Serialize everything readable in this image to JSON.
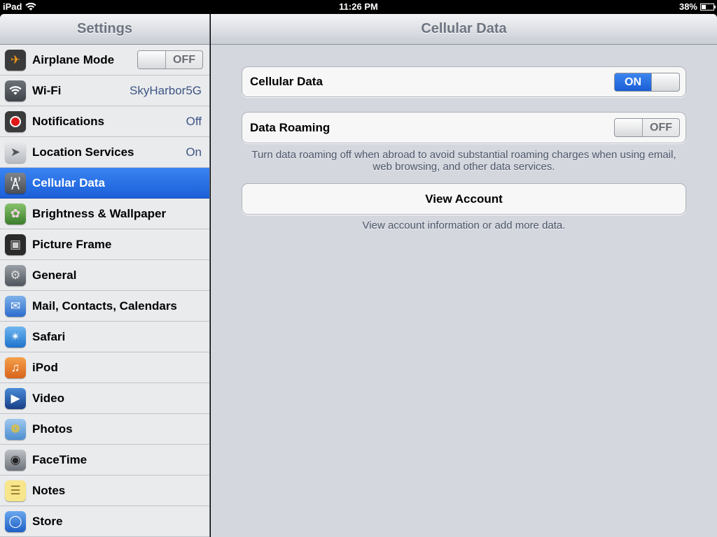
{
  "status": {
    "device": "iPad",
    "time": "11:26 PM",
    "battery": "38%",
    "battery_level": 0.38
  },
  "sidebar": {
    "title": "Settings",
    "items": [
      {
        "label": "Airplane Mode",
        "switch": "OFF",
        "icon": "airplane-icon"
      },
      {
        "label": "Wi-Fi",
        "value": "SkyHarbor5G",
        "icon": "wifi-icon"
      },
      {
        "label": "Notifications",
        "value": "Off",
        "icon": "notifications-icon"
      },
      {
        "label": "Location Services",
        "value": "On",
        "icon": "location-icon"
      },
      {
        "label": "Cellular Data",
        "icon": "cellular-antenna-icon",
        "selected": true
      },
      {
        "label": "Brightness & Wallpaper",
        "icon": "flower-icon"
      },
      {
        "label": "Picture Frame",
        "icon": "picture-frame-icon"
      },
      {
        "label": "General",
        "icon": "gear-icon"
      },
      {
        "label": "Mail, Contacts, Calendars",
        "icon": "mail-icon"
      },
      {
        "label": "Safari",
        "icon": "compass-icon"
      },
      {
        "label": "iPod",
        "icon": "ipod-icon"
      },
      {
        "label": "Video",
        "icon": "clapperboard-icon"
      },
      {
        "label": "Photos",
        "icon": "sunflower-icon"
      },
      {
        "label": "FaceTime",
        "icon": "camera-icon"
      },
      {
        "label": "Notes",
        "icon": "notepad-icon"
      },
      {
        "label": "Store",
        "icon": "app-store-icon"
      }
    ]
  },
  "main": {
    "title": "Cellular Data",
    "cellular_data": {
      "label": "Cellular Data",
      "switch": "ON"
    },
    "data_roaming": {
      "label": "Data Roaming",
      "switch": "OFF"
    },
    "roaming_note": "Turn data roaming off when abroad to avoid substantial roaming charges when using email, web browsing, and other data services.",
    "view_account": {
      "label": "View Account"
    },
    "account_note": "View account information or add more data."
  },
  "colors": {
    "selection": "#1b5fd8",
    "switch_on": "#3c86ef",
    "value_text": "#3d5584"
  }
}
